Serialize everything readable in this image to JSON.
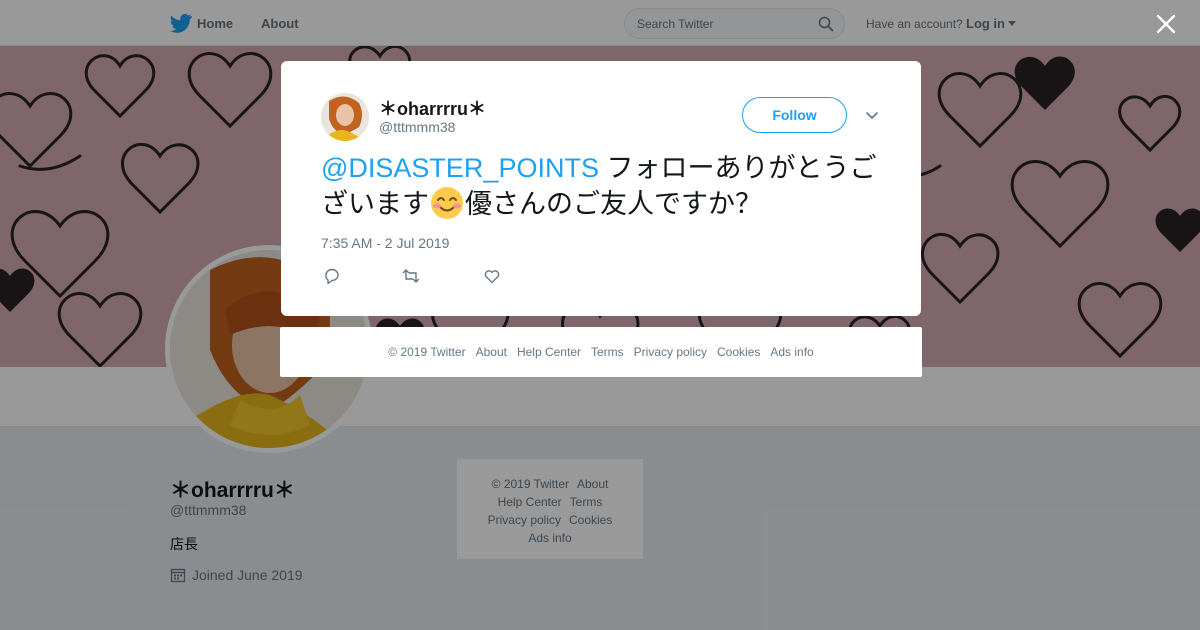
{
  "nav": {
    "home_label": "Home",
    "about_label": "About",
    "search_placeholder": "Search Twitter",
    "account_question": "Have an account?",
    "login_label": "Log in"
  },
  "profile": {
    "name": "＊oharrrru＊",
    "handle": "@tttmmm38",
    "bio": "店長",
    "joined": "Joined June 2019"
  },
  "side_footer": {
    "items": [
      "© 2019 Twitter",
      "About",
      "Help Center",
      "Terms",
      "Privacy policy",
      "Cookies",
      "Ads info"
    ]
  },
  "tweet": {
    "author_name": "＊oharrrru＊",
    "author_handle": "@tttmmm38",
    "follow_label": "Follow",
    "mention": "@DISASTER_POINTS",
    "text_part1": " フォローありがとうございます",
    "text_part2": "優さんのご友人ですか？",
    "timestamp": "7:35 AM - 2 Jul 2019",
    "icons": {
      "reply": "reply-icon",
      "retweet": "retweet-icon",
      "like": "heart-icon",
      "menu": "chevron-down-icon",
      "emoji": "smiling-face-icon"
    }
  },
  "modal_footer": {
    "items": [
      "© 2019 Twitter",
      "About",
      "Help Center",
      "Terms",
      "Privacy policy",
      "Cookies",
      "Ads info"
    ]
  },
  "colors": {
    "brand_blue": "#1da1f2",
    "banner_pink": "#d1a8ae",
    "muted_text": "#657786",
    "page_bg": "#e6ecf0"
  }
}
